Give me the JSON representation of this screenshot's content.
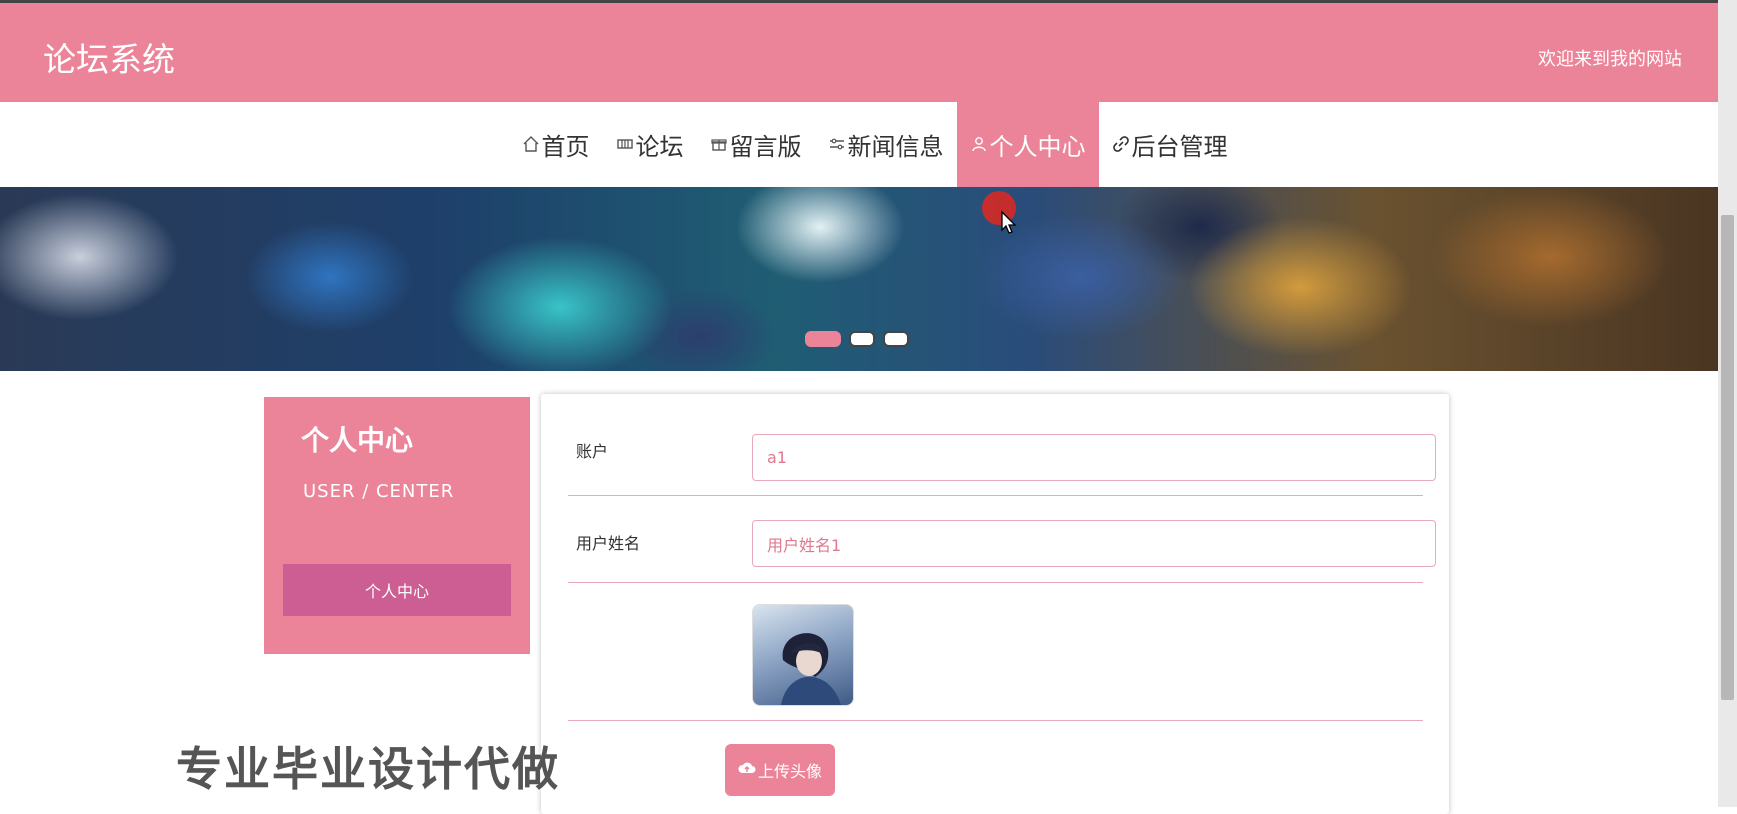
{
  "header": {
    "title": "论坛系统",
    "welcome": "欢迎来到我的网站"
  },
  "nav": {
    "items": [
      {
        "label": "首页",
        "icon": "home-icon"
      },
      {
        "label": "论坛",
        "icon": "grid-icon"
      },
      {
        "label": "留言版",
        "icon": "gift-icon"
      },
      {
        "label": "新闻信息",
        "icon": "sliders-icon"
      },
      {
        "label": "个人中心",
        "icon": "user-icon",
        "active": true
      },
      {
        "label": "后台管理",
        "icon": "link-icon"
      }
    ]
  },
  "banner": {
    "slide_count": 3,
    "active_slide": 1
  },
  "sidebar": {
    "title": "个人中心",
    "subtitle": "USER / CENTER",
    "menu": [
      "个人中心"
    ]
  },
  "form": {
    "account_label": "账户",
    "account_value": "a1",
    "name_label": "用户姓名",
    "name_value": "用户姓名1",
    "upload_label": "上传头像"
  },
  "watermark": "专业毕业设计代做",
  "colors": {
    "primary": "#ec8499",
    "sidebar_button": "#cd5e93",
    "border": "#e7a9b7"
  }
}
